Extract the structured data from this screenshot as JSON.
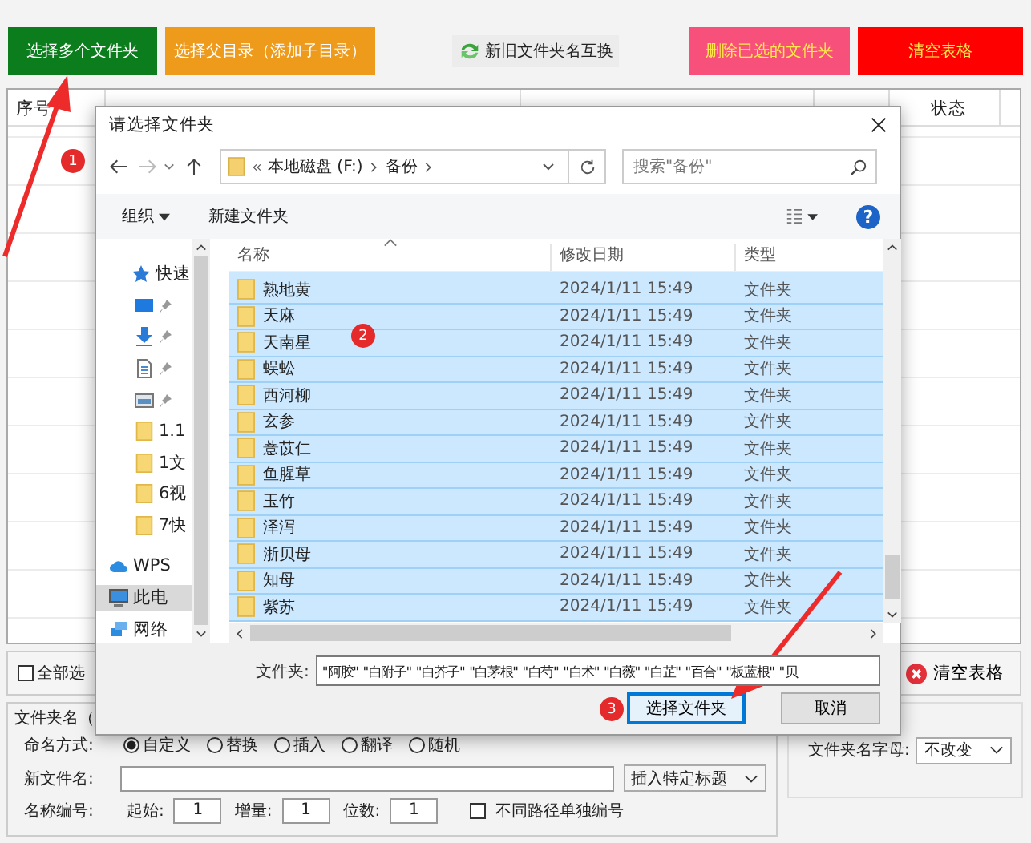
{
  "toolbar": {
    "buttons": [
      {
        "label": "选择多个文件夹",
        "kind": "green"
      },
      {
        "label": "选择父目录（添加子目录）",
        "kind": "orange"
      },
      {
        "label": "新旧文件夹名互换",
        "kind": "swap"
      },
      {
        "label": "删除已选的文件夹",
        "kind": "pink"
      },
      {
        "label": "清空表格",
        "kind": "red"
      }
    ]
  },
  "table": {
    "columns": [
      "序号",
      "状态"
    ]
  },
  "options": {
    "select_all": {
      "label": "全部选",
      "checked": false
    },
    "clear_button": "清空表格",
    "group_title": "文件夹名（",
    "naming_label": "命名方式:",
    "naming_modes": [
      {
        "label": "自定义",
        "selected": true
      },
      {
        "label": "替换",
        "selected": false
      },
      {
        "label": "插入",
        "selected": false
      },
      {
        "label": "翻译",
        "selected": false
      },
      {
        "label": "随机",
        "selected": false
      }
    ],
    "new_name_label": "新文件名:",
    "insert_dropdown": "插入特定标题",
    "numbering_label": "名称编号:",
    "start_label": "起始:",
    "start_value": "1",
    "step_label": "增量:",
    "step_value": "1",
    "digits_label": "位数:",
    "digits_value": "1",
    "separate": {
      "label": "不同路径单独编号",
      "checked": false
    },
    "letter_case": {
      "label": "文件夹名字母:",
      "value": "不改变"
    }
  },
  "dialog": {
    "title": "请选择文件夹",
    "path": [
      "本地磁盘 (F:)",
      "备份"
    ],
    "search": {
      "placeholder": "搜索\"备份\""
    },
    "organize": "组织",
    "help": "?",
    "new_folder": "新建文件夹",
    "nav_items": [
      {
        "label": "快速",
        "kind": "star",
        "selected": false
      },
      {
        "kind": "desktop",
        "selected": false
      },
      {
        "kind": "download",
        "selected": false
      },
      {
        "kind": "document",
        "selected": false
      },
      {
        "kind": "image",
        "selected": false
      },
      {
        "label": "1.1",
        "kind": "folder",
        "selected": false
      },
      {
        "label": "1文",
        "kind": "folder",
        "selected": false
      },
      {
        "label": "6视",
        "kind": "folder",
        "selected": false
      },
      {
        "label": "7快",
        "kind": "folder",
        "selected": false
      },
      {
        "label": "WPS",
        "kind": "cloud",
        "selected": false
      },
      {
        "label": "此电",
        "kind": "pc",
        "selected": true
      },
      {
        "label": "网络",
        "kind": "network",
        "selected": false
      }
    ],
    "columns": [
      "名称",
      "修改日期",
      "类型"
    ],
    "rows": [
      {
        "name": "熟地黄",
        "date": "2024/1/11 15:49",
        "type": "文件夹",
        "selected": true
      },
      {
        "name": "天麻",
        "date": "2024/1/11 15:49",
        "type": "文件夹",
        "selected": true
      },
      {
        "name": "天南星",
        "date": "2024/1/11 15:49",
        "type": "文件夹",
        "selected": true
      },
      {
        "name": "蜈蚣",
        "date": "2024/1/11 15:49",
        "type": "文件夹",
        "selected": true
      },
      {
        "name": "西河柳",
        "date": "2024/1/11 15:49",
        "type": "文件夹",
        "selected": true
      },
      {
        "name": "玄参",
        "date": "2024/1/11 15:49",
        "type": "文件夹",
        "selected": true
      },
      {
        "name": "薏苡仁",
        "date": "2024/1/11 15:49",
        "type": "文件夹",
        "selected": true
      },
      {
        "name": "鱼腥草",
        "date": "2024/1/11 15:49",
        "type": "文件夹",
        "selected": true
      },
      {
        "name": "玉竹",
        "date": "2024/1/11 15:49",
        "type": "文件夹",
        "selected": true
      },
      {
        "name": "泽泻",
        "date": "2024/1/11 15:49",
        "type": "文件夹",
        "selected": true
      },
      {
        "name": "浙贝母",
        "date": "2024/1/11 15:49",
        "type": "文件夹",
        "selected": true
      },
      {
        "name": "知母",
        "date": "2024/1/11 15:49",
        "type": "文件夹",
        "selected": true
      },
      {
        "name": "紫苏",
        "date": "2024/1/11 15:49",
        "type": "文件夹",
        "selected": true
      }
    ],
    "filename_label": "文件夹:",
    "filename_value": "\"阿胶\" \"白附子\" \"白芥子\" \"白茅根\" \"白芍\" \"白术\" \"白薇\" \"白芷\" \"百合\" \"板蓝根\" \"贝",
    "buttons": [
      {
        "label": "选择文件夹",
        "kind": "primary"
      },
      {
        "label": "取消",
        "kind": "normal"
      }
    ]
  },
  "annotations": [
    {
      "label": "1"
    },
    {
      "label": "2"
    },
    {
      "label": "3"
    }
  ]
}
